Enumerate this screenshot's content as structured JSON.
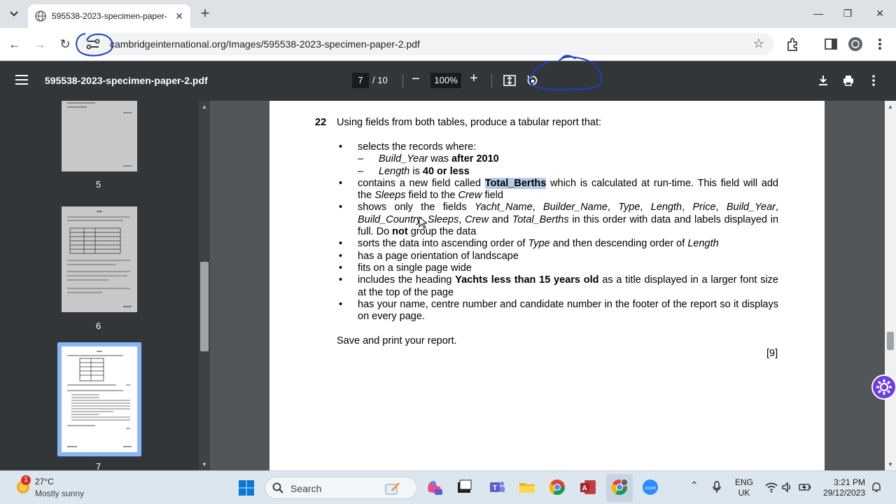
{
  "browser": {
    "tab_title": "595538-2023-specimen-paper-",
    "url": "cambridgeinternational.org/Images/595538-2023-specimen-paper-2.pdf"
  },
  "pdf_toolbar": {
    "title": "595538-2023-specimen-paper-2.pdf",
    "page_current": "7",
    "page_total": "/ 10",
    "zoom": "100%"
  },
  "sidebar": {
    "thumbnails": [
      {
        "label": "5"
      },
      {
        "label": "6"
      },
      {
        "label": "7",
        "selected": true
      }
    ]
  },
  "document": {
    "question_number": "22",
    "question_text": "Using fields from both tables, produce a tabular report that:",
    "b1": "selects the records where:",
    "b1_s1_field": "Build_Year",
    "b1_s1_mid": " was ",
    "b1_s1_bold": "after 2010",
    "b1_s2_field": "Length",
    "b1_s2_mid": " is ",
    "b1_s2_bold": "40 or less",
    "b2_a": "contains a new field called ",
    "b2_hl": "Total_Berths",
    "b2_b": " which is calculated at run-time. This field will add the ",
    "b2_sleeps": "Sleeps",
    "b2_c": " field to the ",
    "b2_crew": "Crew",
    "b2_d": " field",
    "b3_a": "shows only the fields ",
    "b3_f1": "Yacht_Name",
    "b3_f2": "Builder_Name",
    "b3_f3": "Type",
    "b3_f4": "Length",
    "b3_f5": "Price",
    "b3_f6": "Build_Year",
    "b3_f7": "Build_Country",
    "b3_f8": "Sleeps",
    "b3_f9": "Crew",
    "b3_and": " and ",
    "b3_f10": "Total_Berths",
    "b3_b": " in this order with data and labels displayed in full. Do ",
    "b3_not": "not",
    "b3_c": " group the data",
    "b4_a": "sorts the data into ascending order of ",
    "b4_type": "Type",
    "b4_b": " and then descending order of ",
    "b4_length": "Length",
    "b5": "has a page orientation of landscape",
    "b6": "fits on a single page wide",
    "b7_a": "includes the heading ",
    "b7_bold": "Yachts less than 15 years old",
    "b7_b": " as a title displayed in a larger font size at the top of the page",
    "b8": "has your name, centre number and candidate number in the footer of the report so it displays on every page.",
    "save": "Save and print your report.",
    "marks": "[9]"
  },
  "taskbar": {
    "weather_temp": "27°C",
    "weather_desc": "Mostly sunny",
    "weather_badge": "1",
    "search_label": "Search",
    "lang_1": "ENG",
    "lang_2": "UK",
    "time": "3:21 PM",
    "date": "29/12/2023"
  },
  "colors": {
    "pdf_toolbar_bg": "#323639",
    "highlight": "#b4cde6",
    "pen_annotation": "#1a3fbf"
  }
}
